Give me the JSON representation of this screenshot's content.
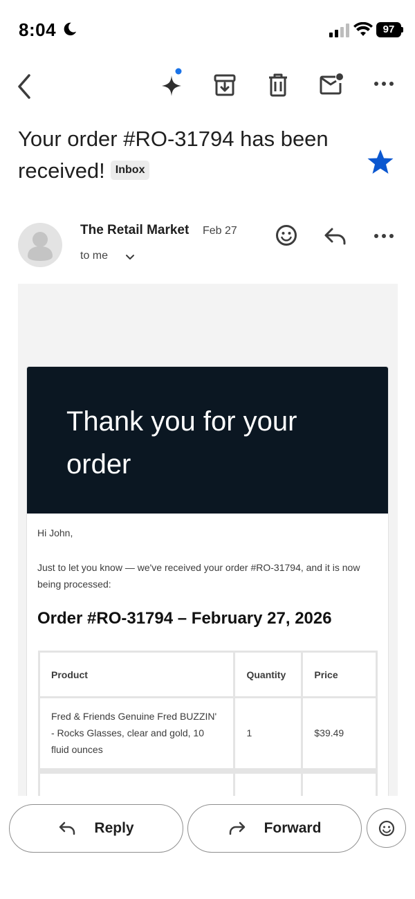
{
  "status_bar": {
    "time": "8:04",
    "battery": "97"
  },
  "subject": {
    "text": "Your order #RO-31794 has been received!",
    "label_chip": "Inbox"
  },
  "sender": {
    "name": "The Retail Market",
    "date": "Feb 27",
    "recipient": "to me"
  },
  "email": {
    "hero_title": "Thank you for your order",
    "greeting": "Hi John,",
    "intro": "Just to let you know — we've received your order #RO-31794, and it is now being processed:",
    "order_heading": "Order #RO-31794 – February 27, 2026",
    "table": {
      "headers": {
        "product": "Product",
        "quantity": "Quantity",
        "price": "Price"
      },
      "rows": [
        {
          "product": "Fred & Friends Genuine Fred BUZZIN' - Rocks Glasses, clear and gold, 10 fluid ounces",
          "quantity": "1",
          "price": "$39.49"
        }
      ]
    }
  },
  "actions": {
    "reply": "Reply",
    "forward": "Forward"
  },
  "colors": {
    "star": "#0b57d0",
    "hero_bg": "#0b1722",
    "notification_dot": "#1a73e8"
  }
}
